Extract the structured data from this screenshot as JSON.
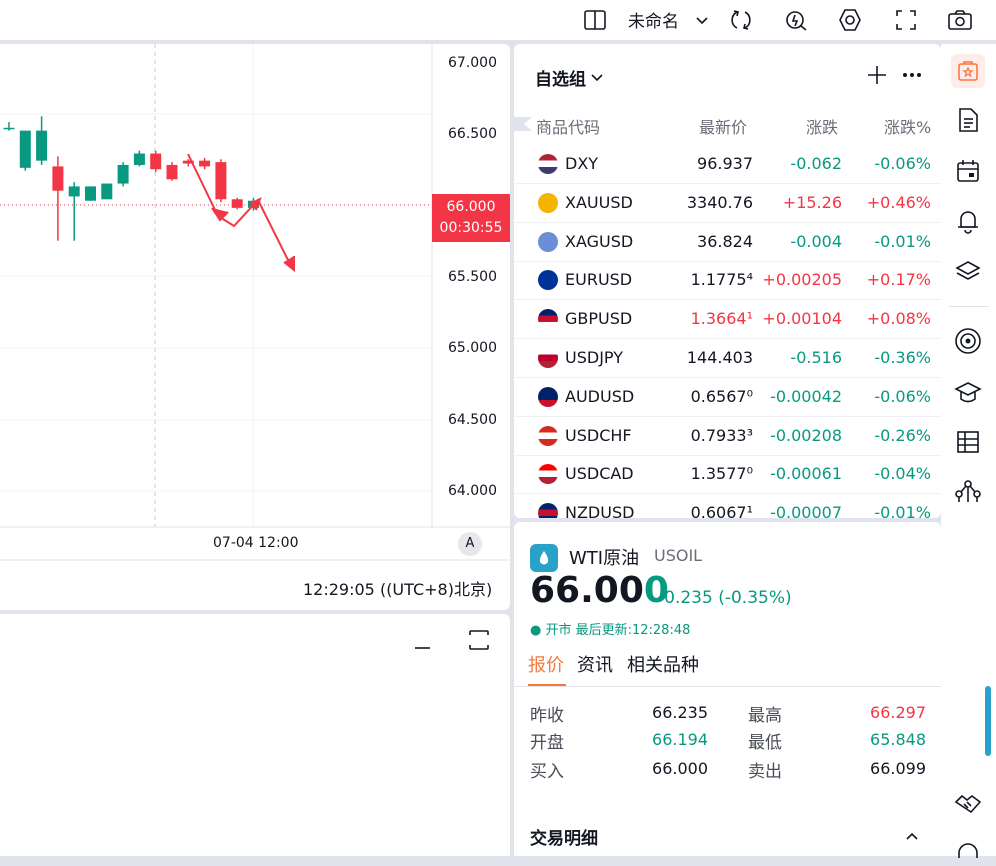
{
  "topbar": {
    "layout_name": "未命名",
    "icons": [
      "layout-toggle-icon",
      "chevron-down-icon",
      "sync-icon",
      "alert-icon",
      "settings-icon",
      "fullscreen-icon",
      "camera-icon"
    ]
  },
  "chart": {
    "price_ticks": [
      "67.000",
      "66.500",
      "66.000",
      "65.500",
      "65.000",
      "64.500",
      "64.000"
    ],
    "current_price": "66.000",
    "countdown": "00:30:55",
    "time_label": "07-04 12:00",
    "auto_label": "A",
    "clock": "12:29:05 ((UTC+8)北京)",
    "candles": [
      {
        "o": 66.54,
        "c": 66.54,
        "h": 66.58,
        "l": 66.52
      },
      {
        "o": 66.26,
        "c": 66.52,
        "h": 66.52,
        "l": 66.24
      },
      {
        "o": 66.31,
        "c": 66.52,
        "h": 66.62,
        "l": 66.28
      },
      {
        "o": 66.27,
        "c": 66.1,
        "h": 66.34,
        "l": 65.75
      },
      {
        "o": 66.06,
        "c": 66.13,
        "h": 66.16,
        "l": 65.75
      },
      {
        "o": 66.03,
        "c": 66.13,
        "h": 66.13,
        "l": 66.03
      },
      {
        "o": 66.04,
        "c": 66.15,
        "h": 66.15,
        "l": 66.04
      },
      {
        "o": 66.15,
        "c": 66.28,
        "h": 66.3,
        "l": 66.13
      },
      {
        "o": 66.28,
        "c": 66.36,
        "h": 66.38,
        "l": 66.27
      },
      {
        "o": 66.36,
        "c": 66.25,
        "h": 66.38,
        "l": 66.23
      },
      {
        "o": 66.28,
        "c": 66.18,
        "h": 66.3,
        "l": 66.17
      },
      {
        "o": 66.31,
        "c": 66.29,
        "h": 66.32,
        "l": 66.27
      },
      {
        "o": 66.31,
        "c": 66.27,
        "h": 66.33,
        "l": 66.25
      },
      {
        "o": 66.3,
        "c": 66.04,
        "h": 66.32,
        "l": 66.02
      },
      {
        "o": 66.04,
        "c": 65.98,
        "h": 66.05,
        "l": 65.97
      },
      {
        "o": 65.98,
        "c": 66.03,
        "h": 66.05,
        "l": 65.96
      }
    ]
  },
  "watchlist": {
    "title": "自选组",
    "headers": {
      "symbol": "商品代码",
      "last": "最新价",
      "change": "涨跌",
      "change_pct": "涨跌%"
    },
    "rows": [
      {
        "symbol": "DXY",
        "last": "96.937",
        "change": "-0.062",
        "change_pct": "-0.06%",
        "dir": "down",
        "last_dir": "neu",
        "flag": "us"
      },
      {
        "symbol": "XAUUSD",
        "last": "3340.76",
        "change": "+15.26",
        "change_pct": "+0.46%",
        "dir": "up",
        "last_dir": "neu",
        "flag": "gold"
      },
      {
        "symbol": "XAGUSD",
        "last": "36.824",
        "change": "-0.004",
        "change_pct": "-0.01%",
        "dir": "down",
        "last_dir": "neu",
        "flag": "silver"
      },
      {
        "symbol": "EURUSD",
        "last": "1.1775⁴",
        "change": "+0.00205",
        "change_pct": "+0.17%",
        "dir": "up",
        "last_dir": "neu",
        "flag": "eu"
      },
      {
        "symbol": "GBPUSD",
        "last": "1.3664¹",
        "change": "+0.00104",
        "change_pct": "+0.08%",
        "dir": "up",
        "last_dir": "up",
        "flag": "gb"
      },
      {
        "symbol": "USDJPY",
        "last": "144.403",
        "change": "-0.516",
        "change_pct": "-0.36%",
        "dir": "down",
        "last_dir": "neu",
        "flag": "jp"
      },
      {
        "symbol": "AUDUSD",
        "last": "0.6567⁰",
        "change": "-0.00042",
        "change_pct": "-0.06%",
        "dir": "down",
        "last_dir": "neu",
        "flag": "au"
      },
      {
        "symbol": "USDCHF",
        "last": "0.7933³",
        "change": "-0.00208",
        "change_pct": "-0.26%",
        "dir": "down",
        "last_dir": "neu",
        "flag": "ch"
      },
      {
        "symbol": "USDCAD",
        "last": "1.3577⁰",
        "change": "-0.00061",
        "change_pct": "-0.04%",
        "dir": "down",
        "last_dir": "neu",
        "flag": "ca"
      },
      {
        "symbol": "NZDUSD",
        "last": "0.6067¹",
        "change": "-0.00007",
        "change_pct": "-0.01%",
        "dir": "down",
        "last_dir": "neu",
        "flag": "nz"
      }
    ]
  },
  "details": {
    "name": "WTI原油",
    "code": "USOIL",
    "price": "66.000",
    "change": "-0.235 (-0.35%)",
    "status": "● 开市 最后更新:12:28:48",
    "tabs": [
      "报价",
      "资讯",
      "相关品种"
    ],
    "quote": [
      {
        "label": "昨收",
        "value": "66.235",
        "dir": "neu"
      },
      {
        "label": "最高",
        "value": "66.297",
        "dir": "up"
      },
      {
        "label": "开盘",
        "value": "66.194",
        "dir": "down"
      },
      {
        "label": "最低",
        "value": "65.848",
        "dir": "down"
      },
      {
        "label": "买入",
        "value": "66.000",
        "dir": "neu"
      },
      {
        "label": "卖出",
        "value": "66.099",
        "dir": "neu"
      }
    ],
    "trade_title": "交易明细"
  },
  "colors": {
    "up": "#f23645",
    "down": "#089981",
    "accent": "#f6793b"
  }
}
